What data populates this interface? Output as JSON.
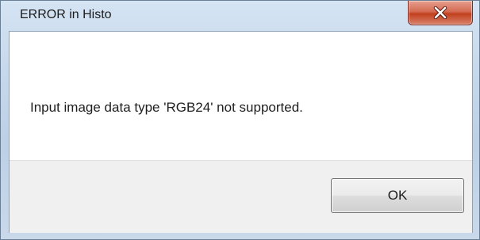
{
  "dialog": {
    "title": "ERROR in Histo",
    "message": "Input image data type 'RGB24' not supported.",
    "ok_label": "OK",
    "close_icon": "close-icon"
  },
  "colors": {
    "close_button": "#c94a2e",
    "frame": "#c6d8eb",
    "button_area": "#f0f0f0"
  }
}
